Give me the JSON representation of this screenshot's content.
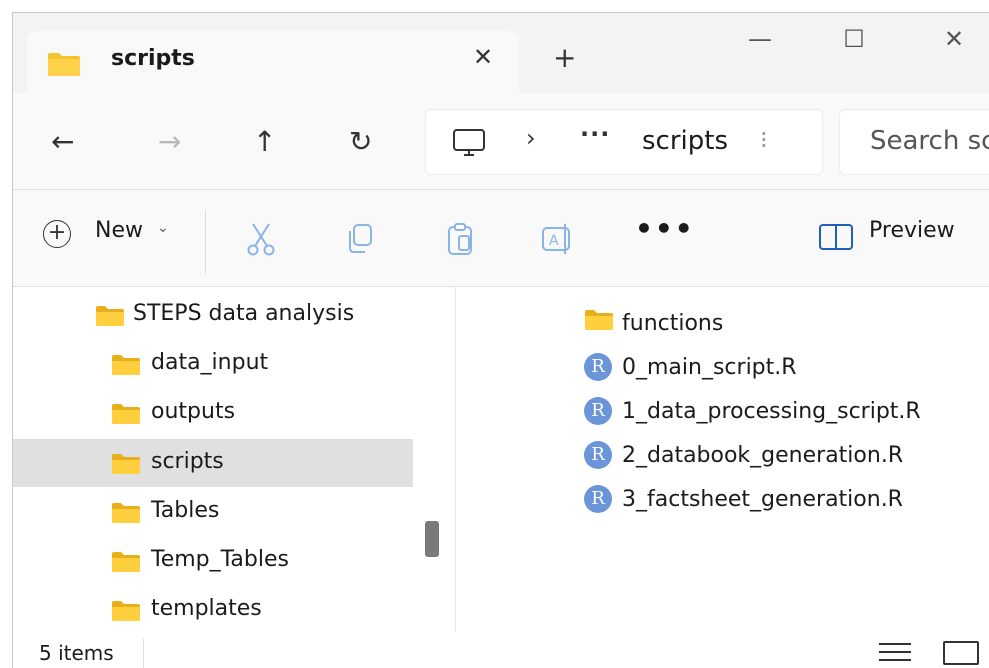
{
  "tab": {
    "title": "scripts"
  },
  "window_controls": {
    "minimize": "—",
    "maximize": "☐",
    "close": "✕",
    "new_tab": "+",
    "close_tab": "✕"
  },
  "nav": {
    "back": "←",
    "forward": "→",
    "up": "↑",
    "refresh": "↻"
  },
  "address": {
    "chevron": "›",
    "ellipsis": "···",
    "current_folder": "scripts",
    "separator": "⁝"
  },
  "search": {
    "placeholder": "Search scripts"
  },
  "toolbar": {
    "new_label": "New",
    "new_caret": "⌄",
    "more": "•••",
    "preview_label": "Preview"
  },
  "sidebar": {
    "items": [
      {
        "label": "STEPS data analysis",
        "selected": false
      },
      {
        "label": "data_input",
        "selected": false
      },
      {
        "label": "outputs",
        "selected": false
      },
      {
        "label": "scripts",
        "selected": true
      },
      {
        "label": "Tables",
        "selected": false
      },
      {
        "label": "Temp_Tables",
        "selected": false
      },
      {
        "label": "templates",
        "selected": false
      }
    ]
  },
  "files": [
    {
      "name": "functions",
      "icon": "folder-icon"
    },
    {
      "name": "0_main_script.R",
      "icon": "r-file-icon"
    },
    {
      "name": "1_data_processing_script.R",
      "icon": "r-file-icon"
    },
    {
      "name": "2_databook_generation.R",
      "icon": "r-file-icon"
    },
    {
      "name": "3_factsheet_generation.R",
      "icon": "r-file-icon"
    }
  ],
  "r_icon_letter": "R",
  "status": {
    "item_count": "5 items"
  },
  "colors": {
    "folder": "#f4c430",
    "folder_dark": "#e0a800",
    "r_icon": "#6a95d8",
    "accent": "#2060b8",
    "selected_bg": "#e0e0e0"
  }
}
